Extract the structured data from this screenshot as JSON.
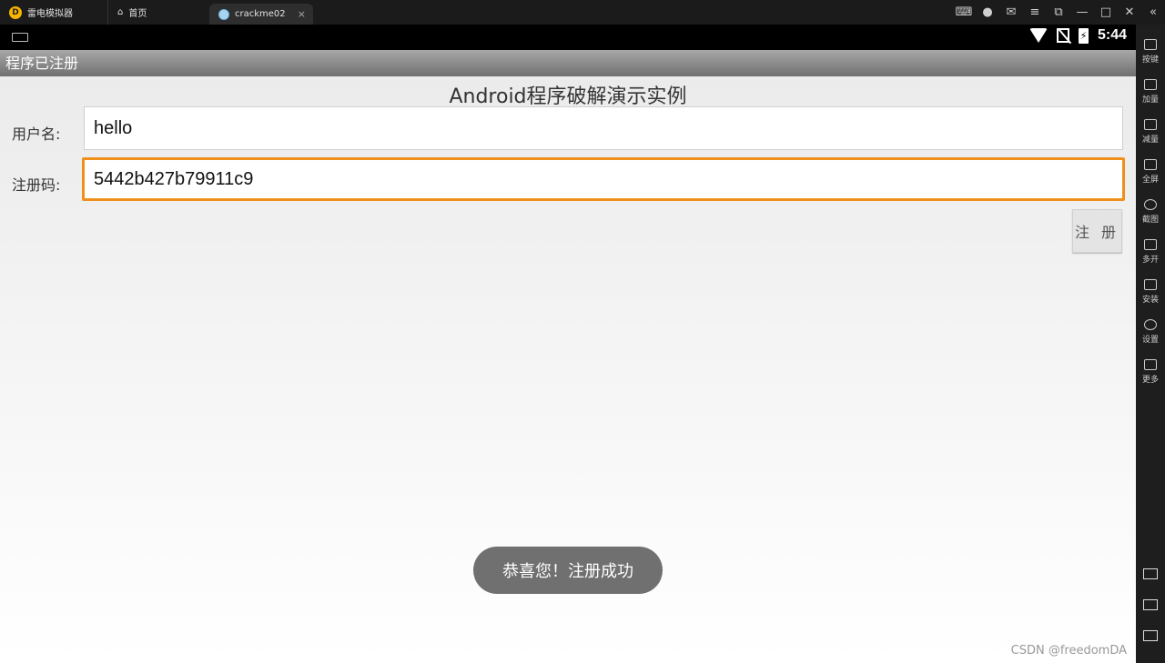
{
  "emulator": {
    "app_name": "雷电模拟器",
    "home_tab": "首页",
    "active_tab": "crackme02",
    "controls": [
      "gamepad-icon",
      "user-icon",
      "mail-icon",
      "menu-icon",
      "fit-icon",
      "minimize-icon",
      "maximize-icon",
      "close-icon",
      "collapse-icon"
    ]
  },
  "statusbar": {
    "time": "5:44"
  },
  "app": {
    "actionbar_title": "程序已注册",
    "heading": "Android程序破解演示实例",
    "username_label": "用户名:",
    "username_value": "hello",
    "code_label": "注册码:",
    "code_value": "5442b427b79911c9",
    "register_button": "注 册",
    "toast": "恭喜您！注册成功"
  },
  "sidebar": {
    "items": [
      {
        "label": "按键",
        "icon": "keyboard-icon"
      },
      {
        "label": "加量",
        "icon": "volume-up-icon"
      },
      {
        "label": "减量",
        "icon": "volume-down-icon"
      },
      {
        "label": "全屏",
        "icon": "fullscreen-icon"
      },
      {
        "label": "截图",
        "icon": "scissors-icon"
      },
      {
        "label": "多开",
        "icon": "multi-instance-icon"
      },
      {
        "label": "安装",
        "icon": "apk-icon"
      },
      {
        "label": "设置",
        "icon": "gear-icon"
      },
      {
        "label": "更多",
        "icon": "more-icon"
      }
    ]
  },
  "watermark": "CSDN @freedomDA"
}
